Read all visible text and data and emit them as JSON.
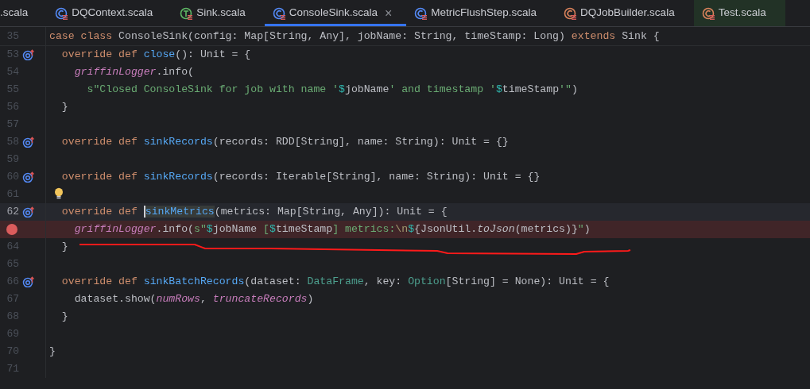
{
  "tabs": [
    {
      "label": ".scala",
      "kind": "none",
      "selected": false,
      "test_scope": false
    },
    {
      "label": "DQContext.scala",
      "kind": "class",
      "selected": false,
      "test_scope": false
    },
    {
      "label": "Sink.scala",
      "kind": "trait",
      "selected": false,
      "test_scope": false
    },
    {
      "label": "ConsoleSink.scala",
      "kind": "class",
      "selected": true,
      "test_scope": false,
      "close_glyph": "×"
    },
    {
      "label": "MetricFlushStep.scala",
      "kind": "class",
      "selected": false,
      "test_scope": false
    },
    {
      "label": "DQJobBuilder.scala",
      "kind": "object",
      "selected": false,
      "test_scope": false
    },
    {
      "label": "Test.scala",
      "kind": "object",
      "selected": false,
      "test_scope": true
    }
  ],
  "sticky_line": {
    "number": "35",
    "code": [
      {
        "t": "case class ",
        "kind": "kw"
      },
      {
        "t": "ConsoleSink(config: Map[String, Any], jobName: String, timeStamp: Long) ",
        "kind": "plain"
      },
      {
        "t": "extends ",
        "kind": "kw"
      },
      {
        "t": "Sink {",
        "kind": "plain"
      }
    ]
  },
  "lines": [
    {
      "number": "53",
      "override_marker": true,
      "breakpoint": false,
      "current": false,
      "bulb": false,
      "code": [
        {
          "t": "  override def ",
          "kind": "kw"
        },
        {
          "t": "close",
          "kind": "fn"
        },
        {
          "t": "(): Unit = {",
          "kind": "plain"
        }
      ]
    },
    {
      "number": "54",
      "override_marker": false,
      "breakpoint": false,
      "current": false,
      "bulb": false,
      "code": [
        {
          "t": "    griffinLogger",
          "kind": "field"
        },
        {
          "t": ".info(",
          "kind": "plain"
        }
      ]
    },
    {
      "number": "55",
      "override_marker": false,
      "breakpoint": false,
      "current": false,
      "bulb": false,
      "code": [
        {
          "t": "      s\"Closed ConsoleSink for job with name '",
          "kind": "str"
        },
        {
          "t": "$",
          "kind": "interp"
        },
        {
          "t": "jobName",
          "kind": "plain"
        },
        {
          "t": "' and timestamp '",
          "kind": "str"
        },
        {
          "t": "$",
          "kind": "interp"
        },
        {
          "t": "timeStamp",
          "kind": "plain"
        },
        {
          "t": "'\"",
          "kind": "str"
        },
        {
          "t": ")",
          "kind": "plain"
        }
      ]
    },
    {
      "number": "56",
      "override_marker": false,
      "breakpoint": false,
      "current": false,
      "bulb": false,
      "code": [
        {
          "t": "  }",
          "kind": "plain"
        }
      ]
    },
    {
      "number": "57",
      "override_marker": false,
      "breakpoint": false,
      "current": false,
      "bulb": false
    },
    {
      "number": "58",
      "override_marker": true,
      "breakpoint": false,
      "current": false,
      "bulb": false,
      "code": [
        {
          "t": "  override def ",
          "kind": "kw"
        },
        {
          "t": "sinkRecords",
          "kind": "fn"
        },
        {
          "t": "(records: RDD[String], name: String): Unit = {}",
          "kind": "plain"
        }
      ]
    },
    {
      "number": "59",
      "override_marker": false,
      "breakpoint": false,
      "current": false,
      "bulb": false
    },
    {
      "number": "60",
      "override_marker": true,
      "breakpoint": false,
      "current": false,
      "bulb": false,
      "code": [
        {
          "t": "  override def ",
          "kind": "kw"
        },
        {
          "t": "sinkRecords",
          "kind": "fn"
        },
        {
          "t": "(records: Iterable[String], name: String): Unit = {}",
          "kind": "plain"
        }
      ]
    },
    {
      "number": "61",
      "override_marker": false,
      "breakpoint": false,
      "current": false,
      "bulb": true
    },
    {
      "number": "62",
      "override_marker": true,
      "breakpoint": false,
      "current": true,
      "bulb": false,
      "code": [
        {
          "t": "  override def ",
          "kind": "kw"
        },
        {
          "t": "sinkMetrics",
          "kind": "fn_caret"
        },
        {
          "t": "(metrics: Map[String, Any]): Unit = {",
          "kind": "plain"
        }
      ]
    },
    {
      "override_marker": false,
      "breakpoint": true,
      "current": false,
      "bulb": false,
      "code": [
        {
          "t": "    griffinLogger",
          "kind": "field"
        },
        {
          "t": ".info(",
          "kind": "plain"
        },
        {
          "t": "s\"",
          "kind": "str"
        },
        {
          "t": "$",
          "kind": "interp"
        },
        {
          "t": "jobName",
          "kind": "plain"
        },
        {
          "t": " [",
          "kind": "str"
        },
        {
          "t": "$",
          "kind": "interp"
        },
        {
          "t": "timeStamp",
          "kind": "plain"
        },
        {
          "t": "] metrics:",
          "kind": "str"
        },
        {
          "t": "\\n",
          "kind": "esc"
        },
        {
          "t": "$",
          "kind": "interp"
        },
        {
          "t": "{JsonUtil.",
          "kind": "plain"
        },
        {
          "t": "toJson",
          "kind": "static"
        },
        {
          "t": "(metrics)}",
          "kind": "plain"
        },
        {
          "t": "\"",
          "kind": "str"
        },
        {
          "t": ")",
          "kind": "plain"
        }
      ]
    },
    {
      "number": "64",
      "override_marker": false,
      "breakpoint": false,
      "current": false,
      "bulb": false,
      "code": [
        {
          "t": "  }",
          "kind": "plain"
        }
      ]
    },
    {
      "number": "65",
      "override_marker": false,
      "breakpoint": false,
      "current": false,
      "bulb": false
    },
    {
      "number": "66",
      "override_marker": true,
      "breakpoint": false,
      "current": false,
      "bulb": false,
      "code": [
        {
          "t": "  override def ",
          "kind": "kw"
        },
        {
          "t": "sinkBatchRecords",
          "kind": "fn"
        },
        {
          "t": "(dataset: ",
          "kind": "plain"
        },
        {
          "t": "DataFrame",
          "kind": "type"
        },
        {
          "t": ", key: ",
          "kind": "plain"
        },
        {
          "t": "Option",
          "kind": "type"
        },
        {
          "t": "[String] = None): Unit = {",
          "kind": "plain"
        }
      ]
    },
    {
      "number": "67",
      "override_marker": false,
      "breakpoint": false,
      "current": false,
      "bulb": false,
      "code": [
        {
          "t": "    dataset.show(",
          "kind": "plain"
        },
        {
          "t": "numRows",
          "kind": "param"
        },
        {
          "t": ", ",
          "kind": "plain"
        },
        {
          "t": "truncateRecords",
          "kind": "param"
        },
        {
          "t": ")",
          "kind": "plain"
        }
      ]
    },
    {
      "number": "68",
      "override_marker": false,
      "breakpoint": false,
      "current": false,
      "bulb": false,
      "code": [
        {
          "t": "  }",
          "kind": "plain"
        }
      ]
    },
    {
      "number": "69",
      "override_marker": false,
      "breakpoint": false,
      "current": false,
      "bulb": false
    },
    {
      "number": "70",
      "override_marker": false,
      "breakpoint": false,
      "current": false,
      "bulb": false,
      "code": [
        {
          "t": "}",
          "kind": "plain"
        }
      ]
    },
    {
      "number": "71",
      "override_marker": false,
      "breakpoint": false,
      "current": false,
      "bulb": false
    }
  ]
}
